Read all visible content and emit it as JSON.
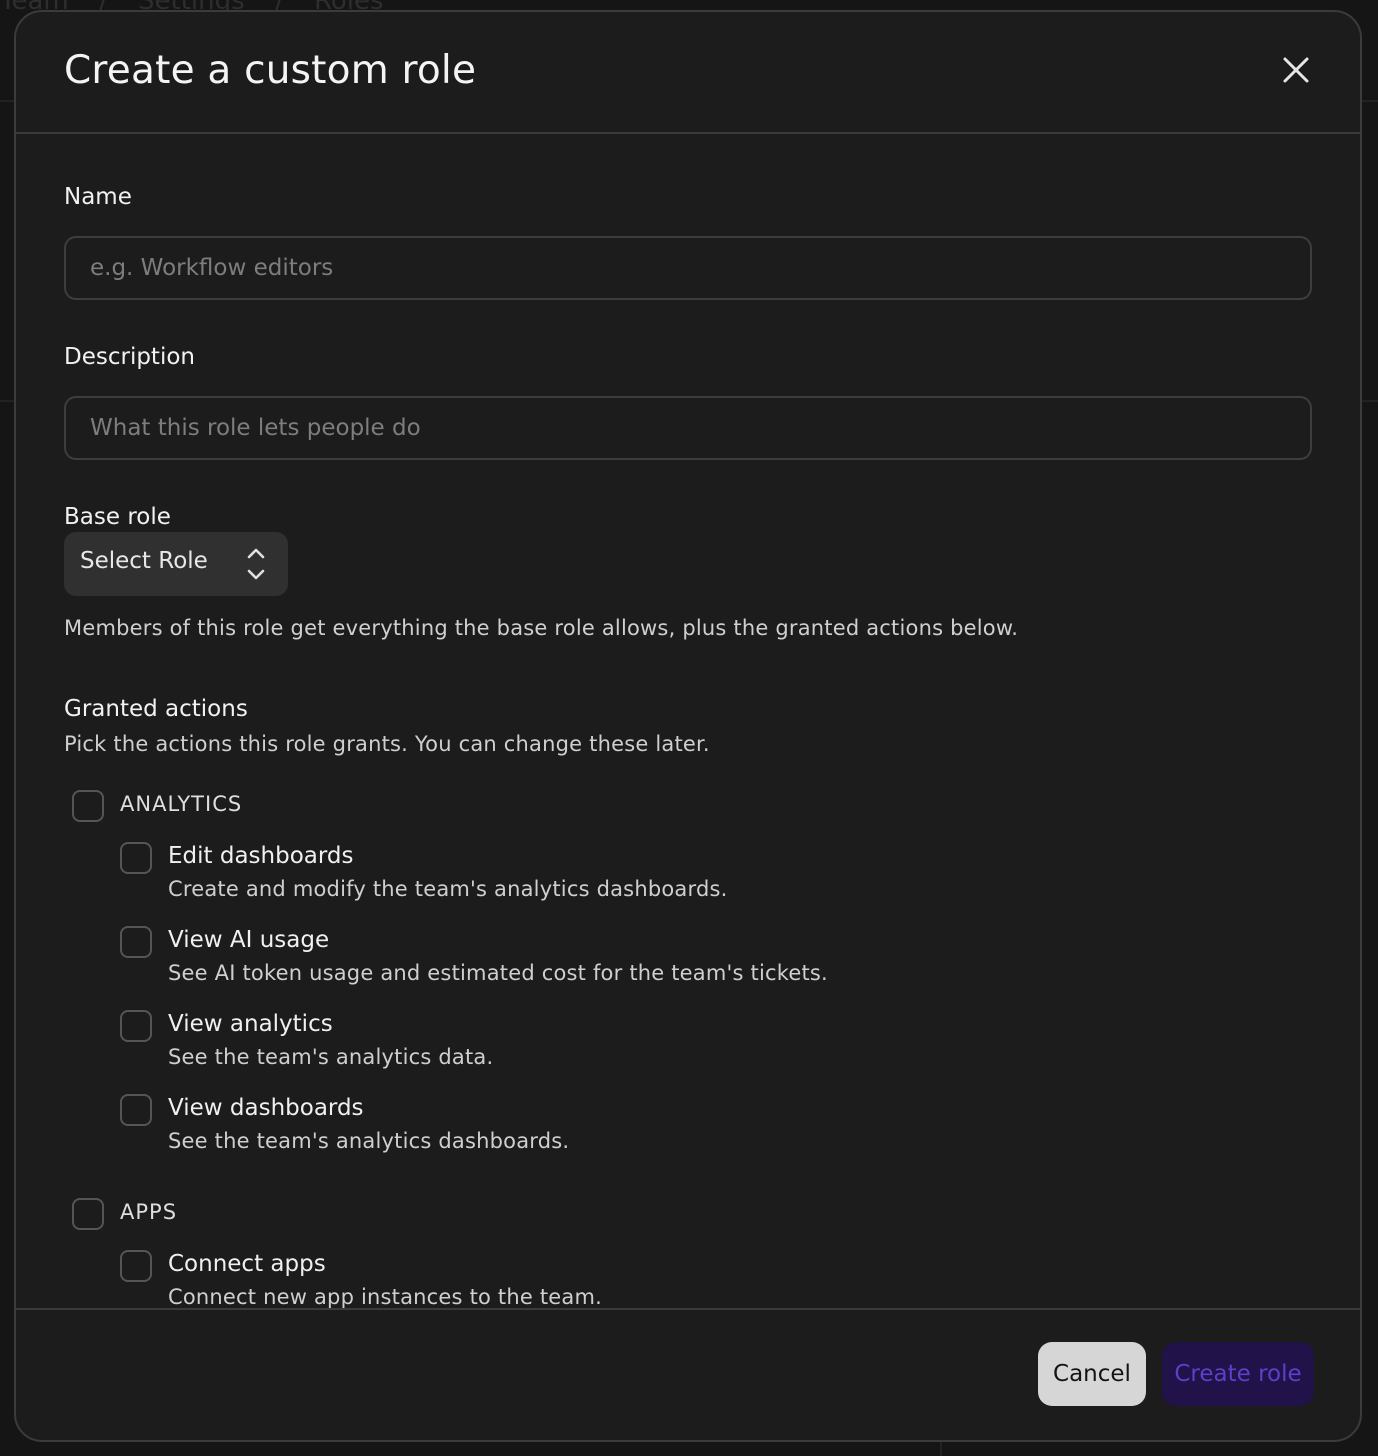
{
  "background": {
    "breadcrumb": [
      "Team",
      "/",
      "Settings",
      "/",
      "Roles"
    ]
  },
  "modal": {
    "title": "Create a custom role",
    "close_icon": "close-icon"
  },
  "form": {
    "name": {
      "label": "Name",
      "value": "",
      "placeholder": "e.g. Workflow editors"
    },
    "description": {
      "label": "Description",
      "value": "",
      "placeholder": "What this role lets people do"
    },
    "base_role": {
      "label": "Base role",
      "selected": "Select Role",
      "help": "Members of this role get everything the base role allows, plus the granted actions below."
    }
  },
  "granted_actions": {
    "title": "Granted actions",
    "subtitle": "Pick the actions this role grants. You can change these later.",
    "groups": [
      {
        "name": "ANALYTICS",
        "checked": false,
        "actions": [
          {
            "title": "Edit dashboards",
            "description": "Create and modify the team's analytics dashboards.",
            "checked": false
          },
          {
            "title": "View AI usage",
            "description": "See AI token usage and estimated cost for the team's tickets.",
            "checked": false
          },
          {
            "title": "View analytics",
            "description": "See the team's analytics data.",
            "checked": false
          },
          {
            "title": "View dashboards",
            "description": "See the team's analytics dashboards.",
            "checked": false
          }
        ]
      },
      {
        "name": "APPS",
        "checked": false,
        "actions": [
          {
            "title": "Connect apps",
            "description": "Connect new app instances to the team.",
            "checked": false
          }
        ]
      }
    ]
  },
  "footer": {
    "cancel_label": "Cancel",
    "create_label": "Create role"
  },
  "colors": {
    "modal_bg": "#1c1c1c",
    "border": "#3a3a3a",
    "primary_button_bg": "#21124a",
    "primary_button_text": "#5d3fc9",
    "secondary_button_bg": "#d6d6d6"
  }
}
